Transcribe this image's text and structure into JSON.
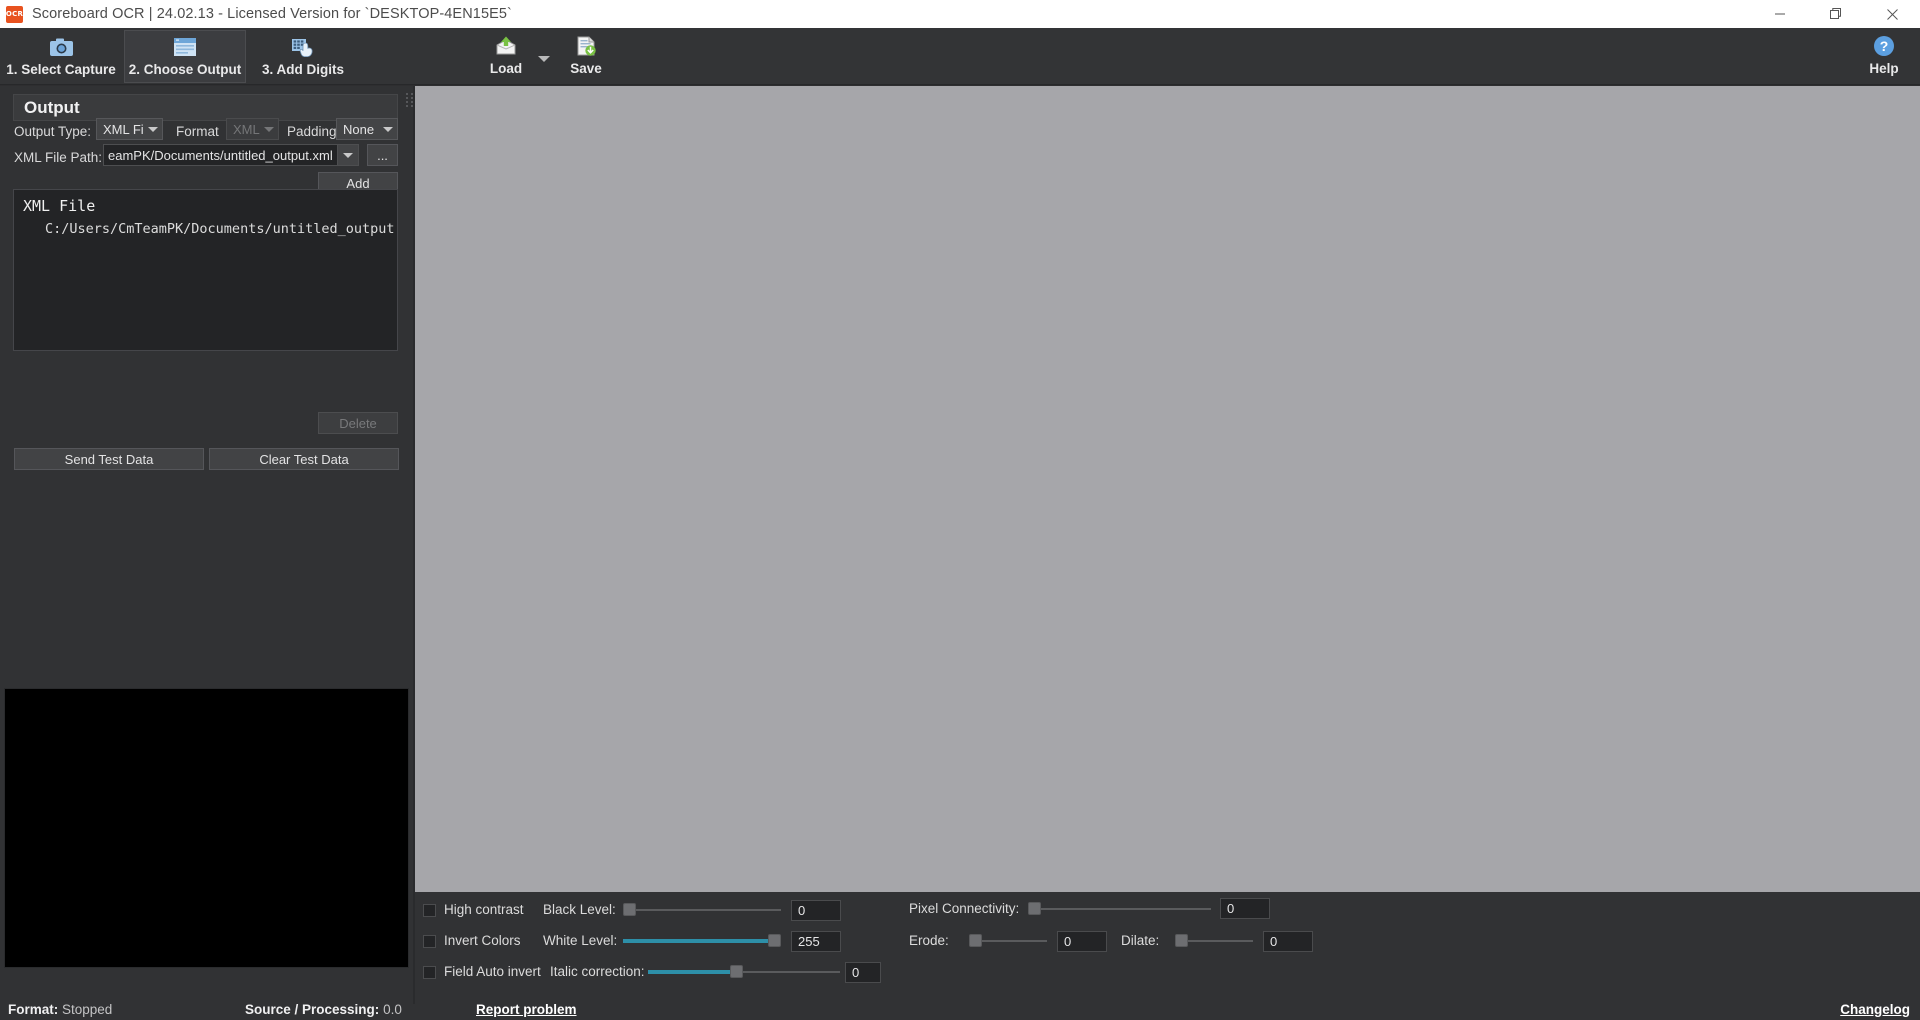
{
  "window": {
    "title": "Scoreboard OCR | 24.02.13 - Licensed Version for `DESKTOP-4EN15E5`",
    "logo_text": "OCR",
    "minimize_icon": "minimize-icon",
    "maximize_icon": "maximize-icon",
    "close_icon": "close-icon"
  },
  "ribbon": {
    "tabs": [
      {
        "label": "1. Select Capture",
        "icon": "camera-icon",
        "active": false
      },
      {
        "label": "2. Choose Output",
        "icon": "output-window-icon",
        "active": true
      },
      {
        "label": "3. Add Digits",
        "icon": "digits-hand-icon",
        "active": false
      }
    ],
    "buttons": [
      {
        "label": "Load",
        "icon": "load-box-icon",
        "has_caret": true
      },
      {
        "label": "Save",
        "icon": "save-document-icon",
        "has_caret": true
      }
    ],
    "help": {
      "label": "Help",
      "icon": "help-question-icon"
    }
  },
  "output_panel": {
    "title": "Output",
    "output_type": {
      "label": "Output Type:",
      "value": "XML File",
      "options": [
        "XML File"
      ]
    },
    "format": {
      "label": "Format",
      "value": "XML",
      "disabled": true,
      "options": [
        "XML"
      ]
    },
    "padding": {
      "label": "Padding",
      "value": "None",
      "options": [
        "None"
      ]
    },
    "file_path": {
      "label": "XML File Path:",
      "value": "eamPK/Documents/untitled_output.xml",
      "full_value": "C:/Users/CmTeamPK/Documents/untitled_output.xml",
      "browse_label": "..."
    },
    "add_button": "Add",
    "delete_button": "Delete",
    "send_test_button": "Send Test Data",
    "clear_test_button": "Clear Test Data",
    "list": {
      "group_label": "XML File",
      "items": [
        "C:/Users/CmTeamPK/Documents/untitled_output"
      ]
    }
  },
  "options": {
    "checkboxes": [
      {
        "label": "High contrast",
        "checked": false
      },
      {
        "label": "Invert Colors",
        "checked": false
      },
      {
        "label": "Field Auto invert",
        "checked": false
      }
    ],
    "sliders": [
      {
        "label": "Black Level:",
        "value": "0",
        "percent": 0
      },
      {
        "label": "White Level:",
        "value": "255",
        "percent": 100
      },
      {
        "label": "Italic correction:",
        "value": "0",
        "percent": 50
      },
      {
        "label": "Pixel Connectivity:",
        "value": "0",
        "percent": 0
      },
      {
        "label": "Erode:",
        "value": "0",
        "percent": 0
      },
      {
        "label": "Dilate:",
        "value": "0",
        "percent": 0
      }
    ]
  },
  "statusbar": {
    "format_label": "Format:",
    "format_value": "Stopped",
    "source_label": "Source / Processing:",
    "source_value": "0.0",
    "report_link": "Report problem",
    "changelog_link": "Changelog"
  },
  "colors": {
    "accent": "#2d8fa8",
    "panel": "#313234",
    "canvas": "#a6a6aa",
    "titlebar": "#ffffff",
    "logo": "#e8521f"
  }
}
